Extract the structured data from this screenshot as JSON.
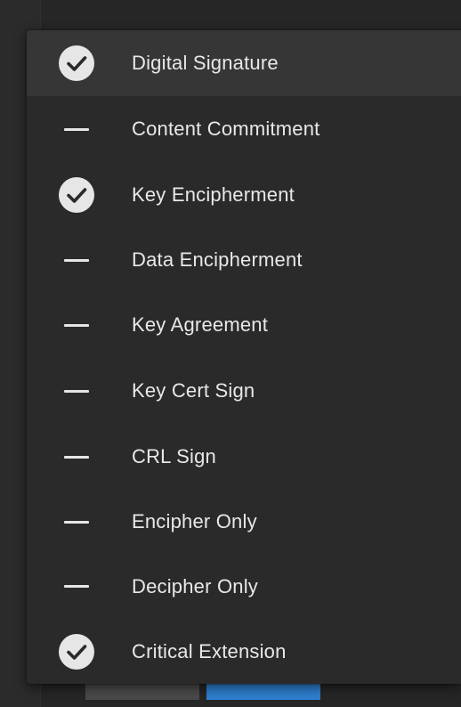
{
  "menu": {
    "items": [
      {
        "label": "Digital Signature",
        "state": "checked",
        "icon": "checkmark-circle-icon"
      },
      {
        "label": "Content Commitment",
        "state": "unchecked",
        "icon": "dash-icon"
      },
      {
        "label": "Key Encipherment",
        "state": "checked",
        "icon": "checkmark-circle-icon"
      },
      {
        "label": "Data Encipherment",
        "state": "unchecked",
        "icon": "dash-icon"
      },
      {
        "label": "Key Agreement",
        "state": "unchecked",
        "icon": "dash-icon"
      },
      {
        "label": "Key Cert Sign",
        "state": "unchecked",
        "icon": "dash-icon"
      },
      {
        "label": "CRL Sign",
        "state": "unchecked",
        "icon": "dash-icon"
      },
      {
        "label": "Encipher Only",
        "state": "unchecked",
        "icon": "dash-icon"
      },
      {
        "label": "Decipher Only",
        "state": "unchecked",
        "icon": "dash-icon"
      },
      {
        "label": "Critical Extension",
        "state": "checked",
        "icon": "checkmark-circle-icon"
      }
    ],
    "highlighted_index": 0
  },
  "colors": {
    "menu_background": "#2a2a2a",
    "highlight_background": "#363636",
    "text": "#e8e8e8",
    "icon": "#e6e6e6",
    "primary_button": "#2f7fd0",
    "secondary_button": "#4a4a4a"
  }
}
